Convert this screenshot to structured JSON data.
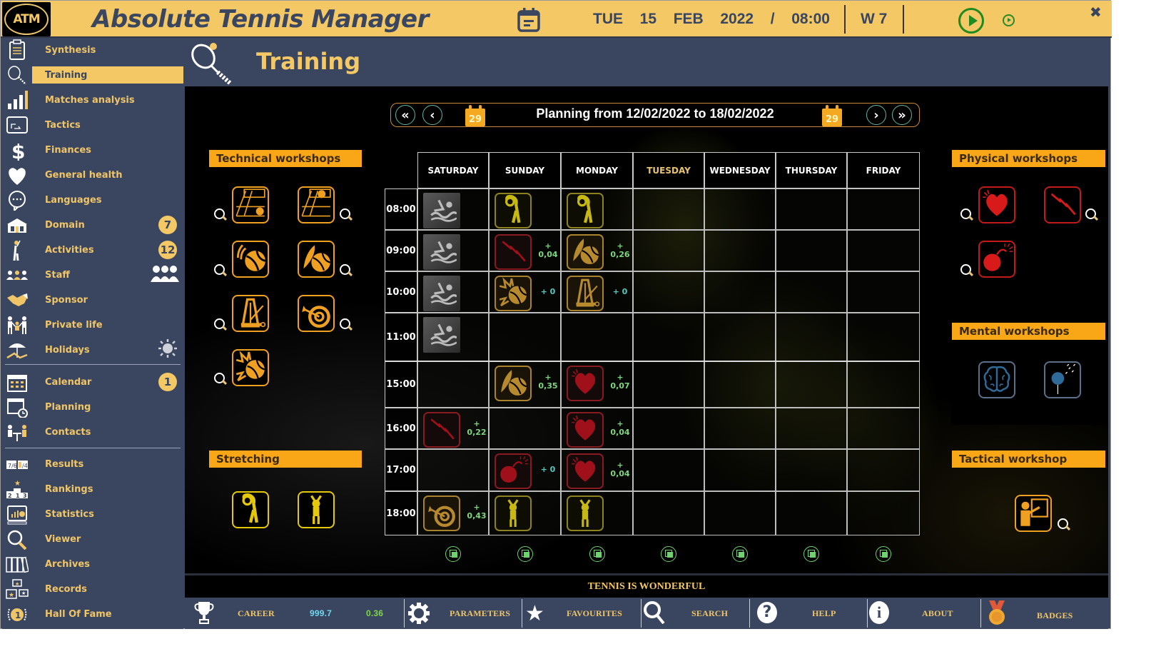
{
  "app": {
    "title": "Absolute Tennis Manager",
    "logo_text": "ATM",
    "date": "TUE  15  FEB  2022  /  08:00",
    "week": "W 7",
    "close": "✖"
  },
  "sidebar": {
    "items": [
      {
        "label": "Synthesis",
        "icon": "clipboard-icon"
      },
      {
        "label": "Training",
        "icon": "racket-icon",
        "active": true
      },
      {
        "label": "Matches analysis",
        "icon": "bar-chart-icon"
      },
      {
        "label": "Tactics",
        "icon": "tactics-board-icon"
      },
      {
        "label": "Finances",
        "icon": "dollar-icon"
      },
      {
        "label": "General health",
        "icon": "heart-icon"
      },
      {
        "label": "Languages",
        "icon": "speech-bubble-icon"
      },
      {
        "label": "Domain",
        "icon": "building-icon",
        "badge": "7"
      },
      {
        "label": "Activities",
        "icon": "golfer-icon",
        "badge": "12"
      },
      {
        "label": "Staff",
        "icon": "staff-people-icon",
        "extra_icon": "group-icon"
      },
      {
        "label": "Sponsor",
        "icon": "handshake-icon"
      },
      {
        "label": "Private life",
        "icon": "family-icon"
      },
      {
        "label": "Holidays",
        "icon": "beach-umbrella-icon",
        "extra_icon": "sun-icon"
      },
      {
        "label": "Calendar",
        "icon": "calendar-icon",
        "badge": "1"
      },
      {
        "label": "Planning",
        "icon": "planning-clock-icon"
      },
      {
        "label": "Contacts",
        "icon": "contacts-desk-icon"
      },
      {
        "label": "Results",
        "icon": "scoreboard-icon"
      },
      {
        "label": "Rankings",
        "icon": "podium-icon"
      },
      {
        "label": "Statistics",
        "icon": "statistics-icon"
      },
      {
        "label": "Viewer",
        "icon": "magnifier-icon"
      },
      {
        "label": "Archives",
        "icon": "binders-icon"
      },
      {
        "label": "Records",
        "icon": "records-stars-icon"
      },
      {
        "label": "Hall Of Fame",
        "icon": "laurel-medal-icon"
      }
    ]
  },
  "page": {
    "title": "Training",
    "planning_title": "Planning from 12/02/2022 to 18/02/2022",
    "calendar_day": "29",
    "nav": {
      "first": "«",
      "prev": "‹",
      "next": "›",
      "last": "»"
    },
    "motto": "TENNIS IS WONDERFUL"
  },
  "workshops": {
    "technical": {
      "title": "Technical workshops",
      "items": [
        "court-serve-icon",
        "court-return-icon",
        "ball-spin-icon",
        "feather-ball-icon",
        "metronome-icon",
        "target-icon",
        "ball-impact-icon"
      ]
    },
    "stretching": {
      "title": "Stretching",
      "items": [
        "side-stretch-icon",
        "arms-up-stretch-icon"
      ]
    },
    "physical": {
      "title": "Physical workshops",
      "items": [
        "heart-cardio-icon",
        "lightning-speed-icon",
        "bomb-power-icon"
      ]
    },
    "mental": {
      "title": "Mental workshops",
      "items": [
        "brain-icon",
        "dandelion-icon"
      ]
    },
    "tactical": {
      "title": "Tactical workshop",
      "items": [
        "coach-board-icon"
      ]
    }
  },
  "schedule": {
    "days": [
      "SATURDAY",
      "SUNDAY",
      "MONDAY",
      "TUESDAY",
      "WEDNESDAY",
      "THURSDAY",
      "FRIDAY"
    ],
    "today_index": 3,
    "times": [
      "08:00",
      "09:00",
      "10:00",
      "11:00",
      "15:00",
      "16:00",
      "17:00",
      "18:00"
    ],
    "entries": [
      {
        "day": 0,
        "time": 0,
        "icon": "swimming-icon",
        "kind": "grey",
        "gain": ""
      },
      {
        "day": 0,
        "time": 1,
        "icon": "swimming-icon",
        "kind": "grey",
        "gain": ""
      },
      {
        "day": 0,
        "time": 2,
        "icon": "swimming-icon",
        "kind": "grey",
        "gain": ""
      },
      {
        "day": 0,
        "time": 3,
        "icon": "swimming-icon",
        "kind": "grey",
        "gain": ""
      },
      {
        "day": 0,
        "time": 5,
        "icon": "lightning-speed-icon",
        "kind": "red",
        "gain": "+\n0,22"
      },
      {
        "day": 0,
        "time": 7,
        "icon": "target-icon",
        "kind": "gold",
        "gain": "+\n0,43"
      },
      {
        "day": 1,
        "time": 0,
        "icon": "side-stretch-icon",
        "kind": "yellow",
        "gain": ""
      },
      {
        "day": 1,
        "time": 1,
        "icon": "lightning-speed-icon",
        "kind": "red",
        "gain": "+\n0,04"
      },
      {
        "day": 1,
        "time": 2,
        "icon": "ball-impact-icon",
        "kind": "gold",
        "gain": "+ 0"
      },
      {
        "day": 1,
        "time": 4,
        "icon": "feather-ball-icon",
        "kind": "gold",
        "gain": "+\n0,35"
      },
      {
        "day": 1,
        "time": 6,
        "icon": "bomb-power-icon",
        "kind": "red",
        "gain": "+ 0"
      },
      {
        "day": 1,
        "time": 7,
        "icon": "arms-up-stretch-icon",
        "kind": "yellow",
        "gain": ""
      },
      {
        "day": 2,
        "time": 0,
        "icon": "side-stretch-icon",
        "kind": "yellow",
        "gain": ""
      },
      {
        "day": 2,
        "time": 1,
        "icon": "feather-ball-icon",
        "kind": "gold",
        "gain": "+\n0,26"
      },
      {
        "day": 2,
        "time": 2,
        "icon": "metronome-icon",
        "kind": "gold",
        "gain": "+ 0"
      },
      {
        "day": 2,
        "time": 4,
        "icon": "heart-cardio-icon",
        "kind": "red",
        "gain": "+\n0,07"
      },
      {
        "day": 2,
        "time": 5,
        "icon": "heart-cardio-icon",
        "kind": "red",
        "gain": "+\n0,04"
      },
      {
        "day": 2,
        "time": 6,
        "icon": "heart-cardio-icon",
        "kind": "red",
        "gain": "+\n0,04"
      },
      {
        "day": 2,
        "time": 7,
        "icon": "arms-up-stretch-icon",
        "kind": "yellow",
        "gain": ""
      }
    ]
  },
  "footer": {
    "career_label": "CAREER",
    "career_value": "999.7",
    "career_delta": "0.36",
    "parameters": "PARAMETERS",
    "favourites": "FAVOURITES",
    "search": "SEARCH",
    "help": "HELP",
    "about": "ABOUT",
    "badges": "BADGES"
  },
  "colors": {
    "accent": "#f4c864",
    "panel": "#3a4660",
    "workshop_header": "#f9a617",
    "gain_positive": "#7ed67e",
    "gain_zero": "#58c8c0"
  }
}
